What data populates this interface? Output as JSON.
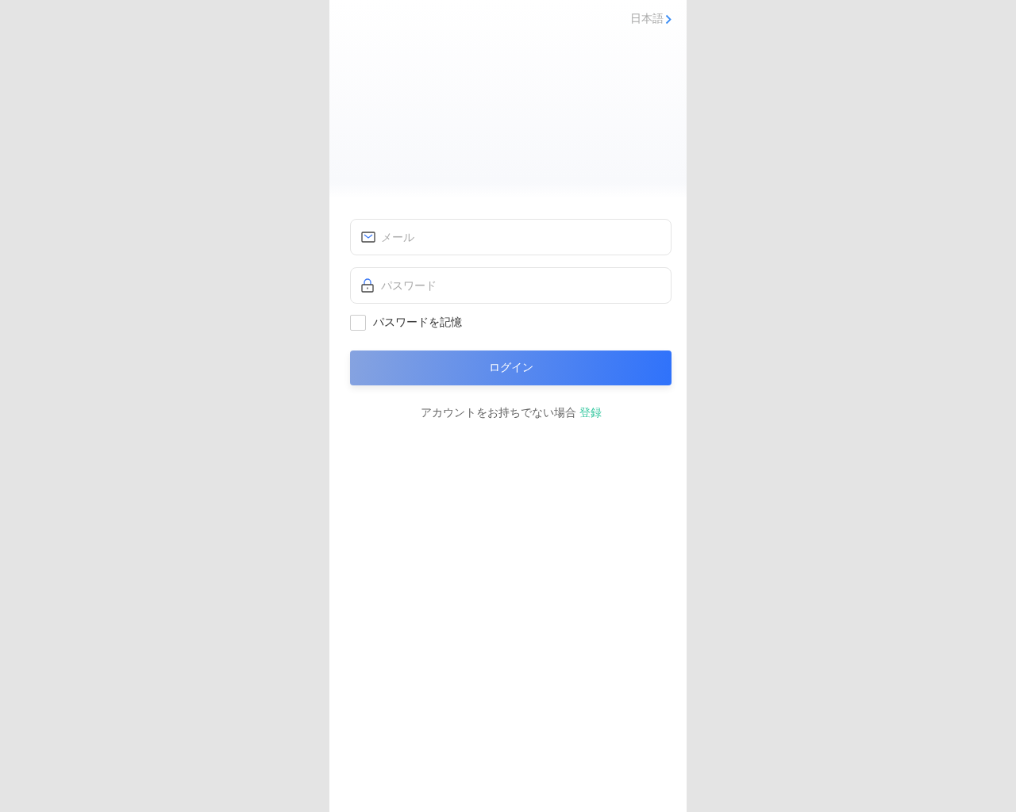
{
  "language": {
    "label": "日本語"
  },
  "fields": [
    {
      "kind": "email",
      "placeholder": "メール"
    },
    {
      "kind": "password",
      "placeholder": "パスワード"
    }
  ],
  "remember": {
    "label": "パスワードを記憶",
    "checked": false
  },
  "login_button": {
    "label": "ログイン"
  },
  "signup": {
    "text": "アカウントをお持ちでない場合",
    "link": "登録"
  }
}
